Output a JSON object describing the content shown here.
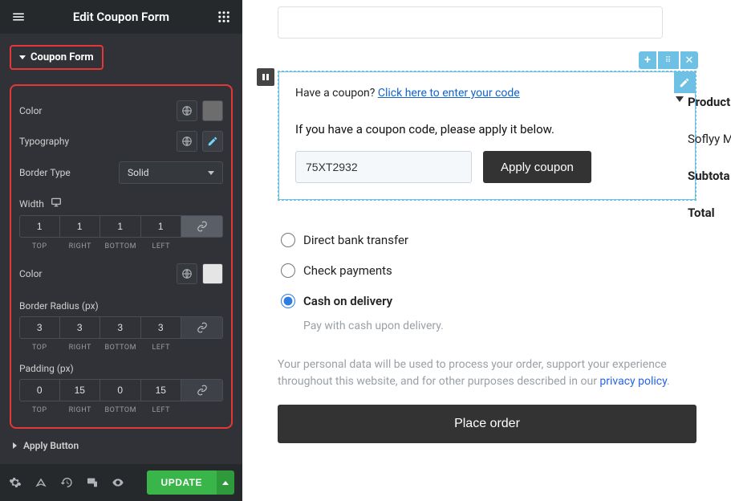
{
  "sidebar": {
    "title": "Edit Coupon Form",
    "section_label": "Coupon Form",
    "color_label": "Color",
    "typography_label": "Typography",
    "border_type_label": "Border Type",
    "border_type_value": "Solid",
    "width_label": "Width",
    "width_values": {
      "top": "1",
      "right": "1",
      "bottom": "1",
      "left": "1"
    },
    "color2_label": "Color",
    "border_radius_label": "Border Radius (px)",
    "radius_values": {
      "top": "3",
      "right": "3",
      "bottom": "3",
      "left": "3"
    },
    "padding_label": "Padding (px)",
    "padding_values": {
      "top": "0",
      "right": "15",
      "bottom": "0",
      "left": "15"
    },
    "dim_caps": {
      "top": "TOP",
      "right": "RIGHT",
      "bottom": "BOTTOM",
      "left": "LEFT"
    },
    "apply_button_label": "Apply Button",
    "update_label": "UPDATE"
  },
  "preview": {
    "coupon_prompt_text": "Have a coupon? ",
    "coupon_prompt_link": "Click here to enter your code",
    "coupon_instruction": "If you have a coupon code, please apply it below.",
    "coupon_value": "75XT2932",
    "apply_coupon_label": "Apply coupon",
    "payments": {
      "bank": "Direct bank transfer",
      "check": "Check payments",
      "cod": "Cash on delivery",
      "cod_desc": "Pay with cash upon delivery."
    },
    "privacy_text_a": "Your personal data will be used to process your order, support your experience throughout this website, and for other purposes described in our ",
    "privacy_link": "privacy policy",
    "privacy_text_b": ".",
    "place_order_label": "Place order",
    "right": {
      "product": "Product",
      "sofly": "Soflyy M",
      "subtotal": "Subtota",
      "total": "Total"
    }
  }
}
